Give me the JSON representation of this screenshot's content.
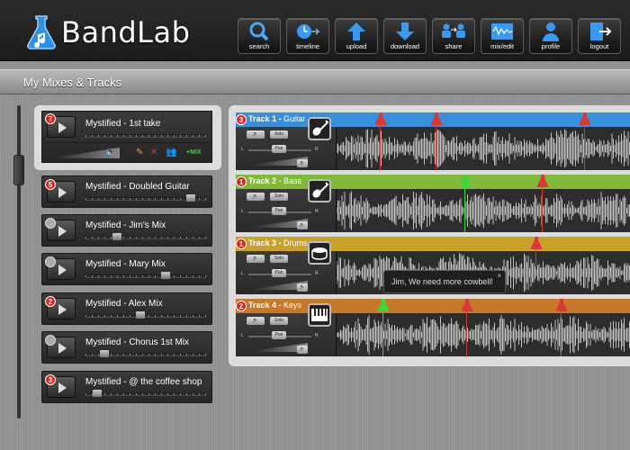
{
  "app": {
    "name": "BandLab"
  },
  "nav": [
    {
      "label": "search",
      "icon": "search-icon"
    },
    {
      "label": "timeline",
      "icon": "timeline-icon"
    },
    {
      "label": "upload",
      "icon": "upload-icon"
    },
    {
      "label": "download",
      "icon": "download-icon"
    },
    {
      "label": "share",
      "icon": "share-icon"
    },
    {
      "label": "mix/edit",
      "icon": "mix-edit-icon"
    },
    {
      "label": "profile",
      "icon": "profile-icon"
    },
    {
      "label": "logout",
      "icon": "logout-icon"
    }
  ],
  "page_title": "My Mixes & Tracks",
  "mixes": [
    {
      "name": "Mystified - 1st take",
      "badge": "7",
      "badge_color": "red",
      "active": true
    },
    {
      "name": "Mystified - Doubled Guitar",
      "badge": "5",
      "badge_color": "red"
    },
    {
      "name": "Mystified - Jim's Mix",
      "badge": "",
      "badge_color": "grey"
    },
    {
      "name": "Mystified - Mary Mix",
      "badge": "",
      "badge_color": "grey"
    },
    {
      "name": "Mystified - Alex Mix",
      "badge": "2",
      "badge_color": "red"
    },
    {
      "name": "Mystified - Chorus 1st Mix",
      "badge": "",
      "badge_color": "grey"
    },
    {
      "name": "Mystified - @ the coffee shop",
      "badge": "3",
      "badge_color": "red"
    }
  ],
  "active_tools": {
    "mix_label": "+MIX"
  },
  "tracks": [
    {
      "label": "Track 1",
      "instrument": "Guitar",
      "badge": "3",
      "color": "#3a8fd8",
      "icon": "guitar-icon"
    },
    {
      "label": "Track 2",
      "instrument": "Bass",
      "badge": "1",
      "color": "#7fb83a",
      "icon": "bass-guitar-icon"
    },
    {
      "label": "Track 3",
      "instrument": "Drums",
      "badge": "1",
      "color": "#c8a12a",
      "icon": "drum-icon"
    },
    {
      "label": "Track 4",
      "instrument": "Keys",
      "badge": "2",
      "color": "#c8782a",
      "icon": "keyboard-icon"
    }
  ],
  "controls": {
    "solo": "Solo",
    "pan": "Pan",
    "left": "L",
    "right": "R"
  },
  "tooltip": {
    "text": "Jim, We need more cowbell!",
    "close": "×"
  },
  "colors": {
    "marker_red": "#d83a3a",
    "marker_green": "#3ad83a"
  }
}
